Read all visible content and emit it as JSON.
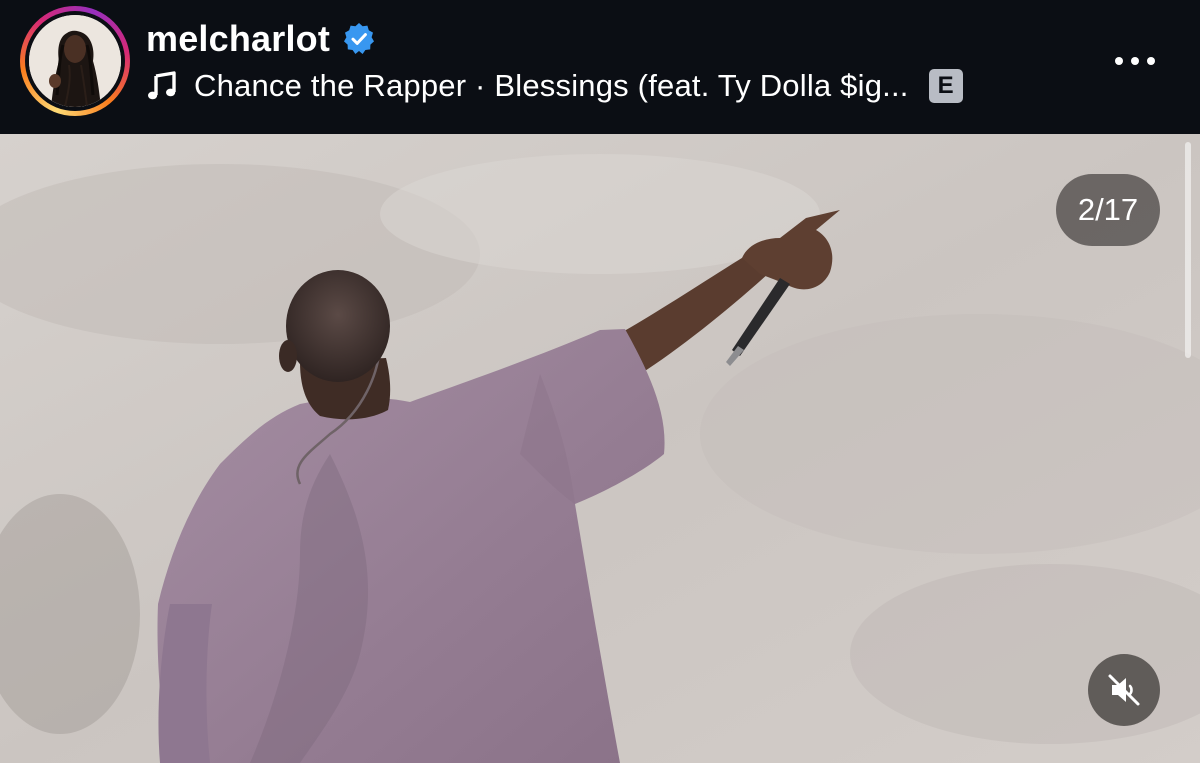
{
  "post": {
    "username": "melcharlot",
    "verified": true,
    "audio_text": "Chance the Rapper · Blessings (feat. Ty Dolla $ig...",
    "explicit_badge": "E"
  },
  "carousel": {
    "counter": "2/17",
    "current": 2,
    "total": 17
  },
  "icons": {
    "avatar": "profile-photo",
    "verified": "verified-badge-icon",
    "music": "music-note-icon",
    "more": "more-options-icon",
    "mute": "speaker-muted-icon"
  },
  "colors": {
    "header_bg": "#0b0e14",
    "verified_blue": "#3897f0",
    "shirt": "#9b8399",
    "sky": "#cfc9c5"
  }
}
